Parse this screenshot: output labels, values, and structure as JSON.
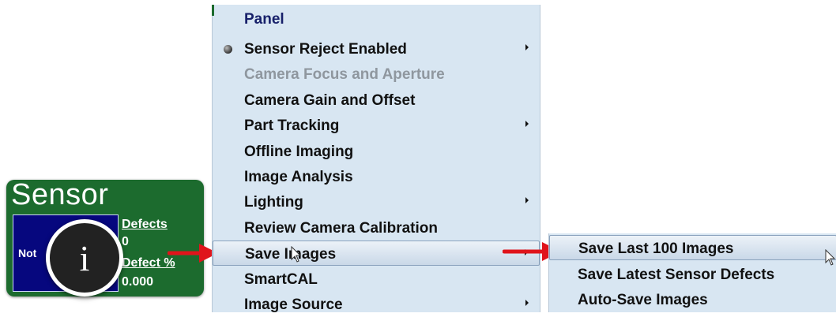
{
  "sensor_tile": {
    "title": "Sensor",
    "status_text": "Not",
    "defects_label": "Defects",
    "defects_value": "0",
    "defect_pct_label": "Defect %",
    "defect_pct_value": "0.000",
    "tile_color": "#1c6b2e",
    "box_color": "#06077e"
  },
  "info_badge": {
    "glyph": "i",
    "icon": "info-icon"
  },
  "menu": {
    "header": "Panel",
    "items": [
      {
        "label": "Sensor Reject Enabled",
        "checked": true,
        "submenu": true,
        "enabled": true
      },
      {
        "label": "Camera Focus and Aperture",
        "submenu": false,
        "enabled": false
      },
      {
        "label": "Camera Gain and Offset",
        "submenu": false,
        "enabled": true
      },
      {
        "label": "Part Tracking",
        "submenu": true,
        "enabled": true
      },
      {
        "label": "Offline Imaging",
        "submenu": false,
        "enabled": true
      },
      {
        "label": "Image Analysis",
        "submenu": false,
        "enabled": true
      },
      {
        "label": "Lighting",
        "submenu": true,
        "enabled": true
      },
      {
        "label": "Review Camera Calibration",
        "submenu": false,
        "enabled": true
      },
      {
        "label": "Save Images",
        "submenu": true,
        "enabled": true,
        "highlighted": true
      },
      {
        "label": "SmartCAL",
        "submenu": false,
        "enabled": true
      },
      {
        "label": "Image Source",
        "submenu": true,
        "enabled": true
      }
    ]
  },
  "submenu": {
    "items": [
      {
        "label": "Save Last 100 Images",
        "highlighted": true
      },
      {
        "label": "Save Latest Sensor Defects"
      },
      {
        "label": "Auto-Save Images"
      }
    ]
  },
  "colors": {
    "menu_bg": "#d8e6f2",
    "arrow": "#e0141b",
    "header_text": "#17206a",
    "disabled_text": "#8f979f"
  }
}
